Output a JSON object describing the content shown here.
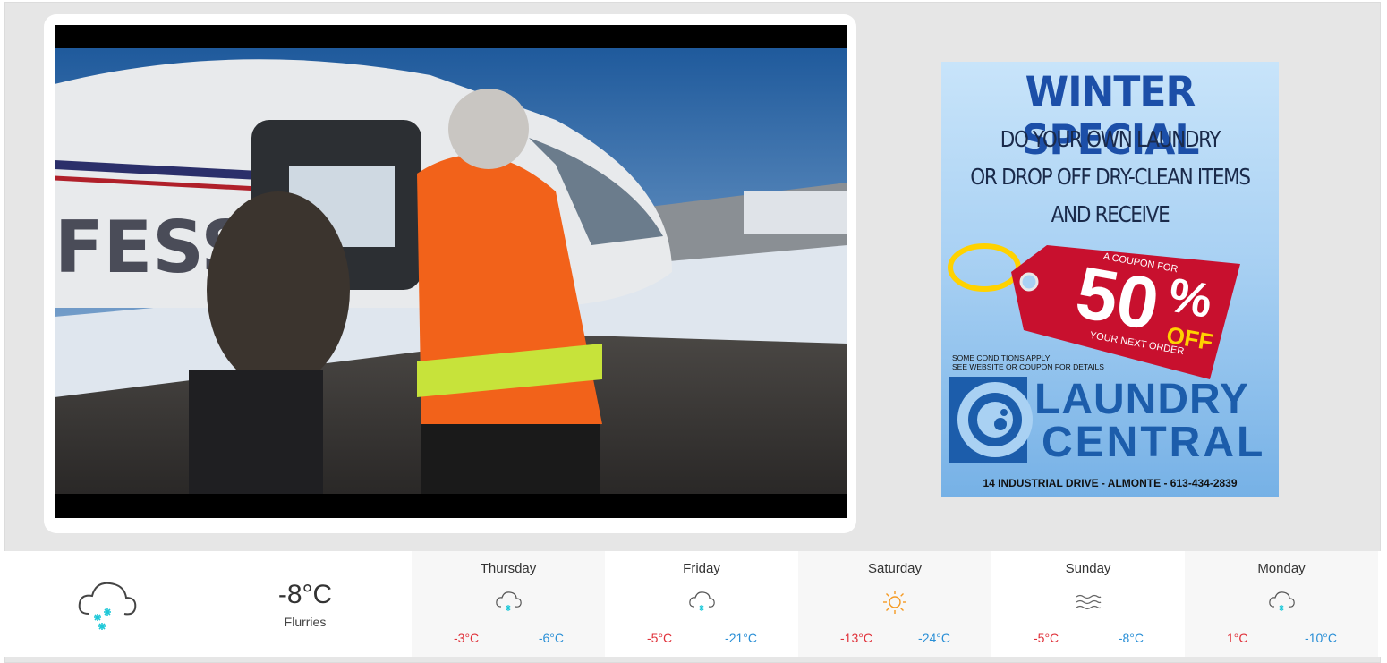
{
  "ad": {
    "title": "WINTER SPECIAL",
    "line1": "DO YOUR OWN LAUNDRY",
    "line2": "OR DROP OFF DRY-CLEAN ITEMS",
    "line3": "AND RECEIVE",
    "coupon_for": "A COUPON FOR",
    "discount": "50",
    "percent": "%",
    "off": "OFF",
    "next_order": "YOUR NEXT ORDER",
    "conditions1": "SOME CONDITIONS APPLY",
    "conditions2": "SEE WEBSITE OR COUPON FOR DETAILS",
    "brand1": "LAUNDRY",
    "brand2": "CENTRAL",
    "address": "14 INDUSTRIAL DRIVE - ALMONTE - 613-434-2839",
    "colors": {
      "title": "#1c4fa8",
      "tag": "#c8102e",
      "brand": "#1c5dab",
      "off": "#ffd200"
    }
  },
  "weather": {
    "current": {
      "icon": "snow-cloud-icon",
      "temp": "-8°C",
      "condition": "Flurries"
    },
    "forecast": [
      {
        "day": "Thursday",
        "icon": "snow-cloud-icon",
        "high": "-3°C",
        "low": "-6°C"
      },
      {
        "day": "Friday",
        "icon": "snow-cloud-icon",
        "high": "-5°C",
        "low": "-21°C"
      },
      {
        "day": "Saturday",
        "icon": "sun-icon",
        "high": "-13°C",
        "low": "-24°C"
      },
      {
        "day": "Sunday",
        "icon": "fog-icon",
        "high": "-5°C",
        "low": "-8°C"
      },
      {
        "day": "Monday",
        "icon": "snow-cloud-icon",
        "high": "1°C",
        "low": "-10°C"
      }
    ],
    "colors": {
      "high": "#e0313a",
      "low": "#2a8fd6",
      "snow": "#1ec8d8",
      "sun": "#f59a23"
    }
  }
}
